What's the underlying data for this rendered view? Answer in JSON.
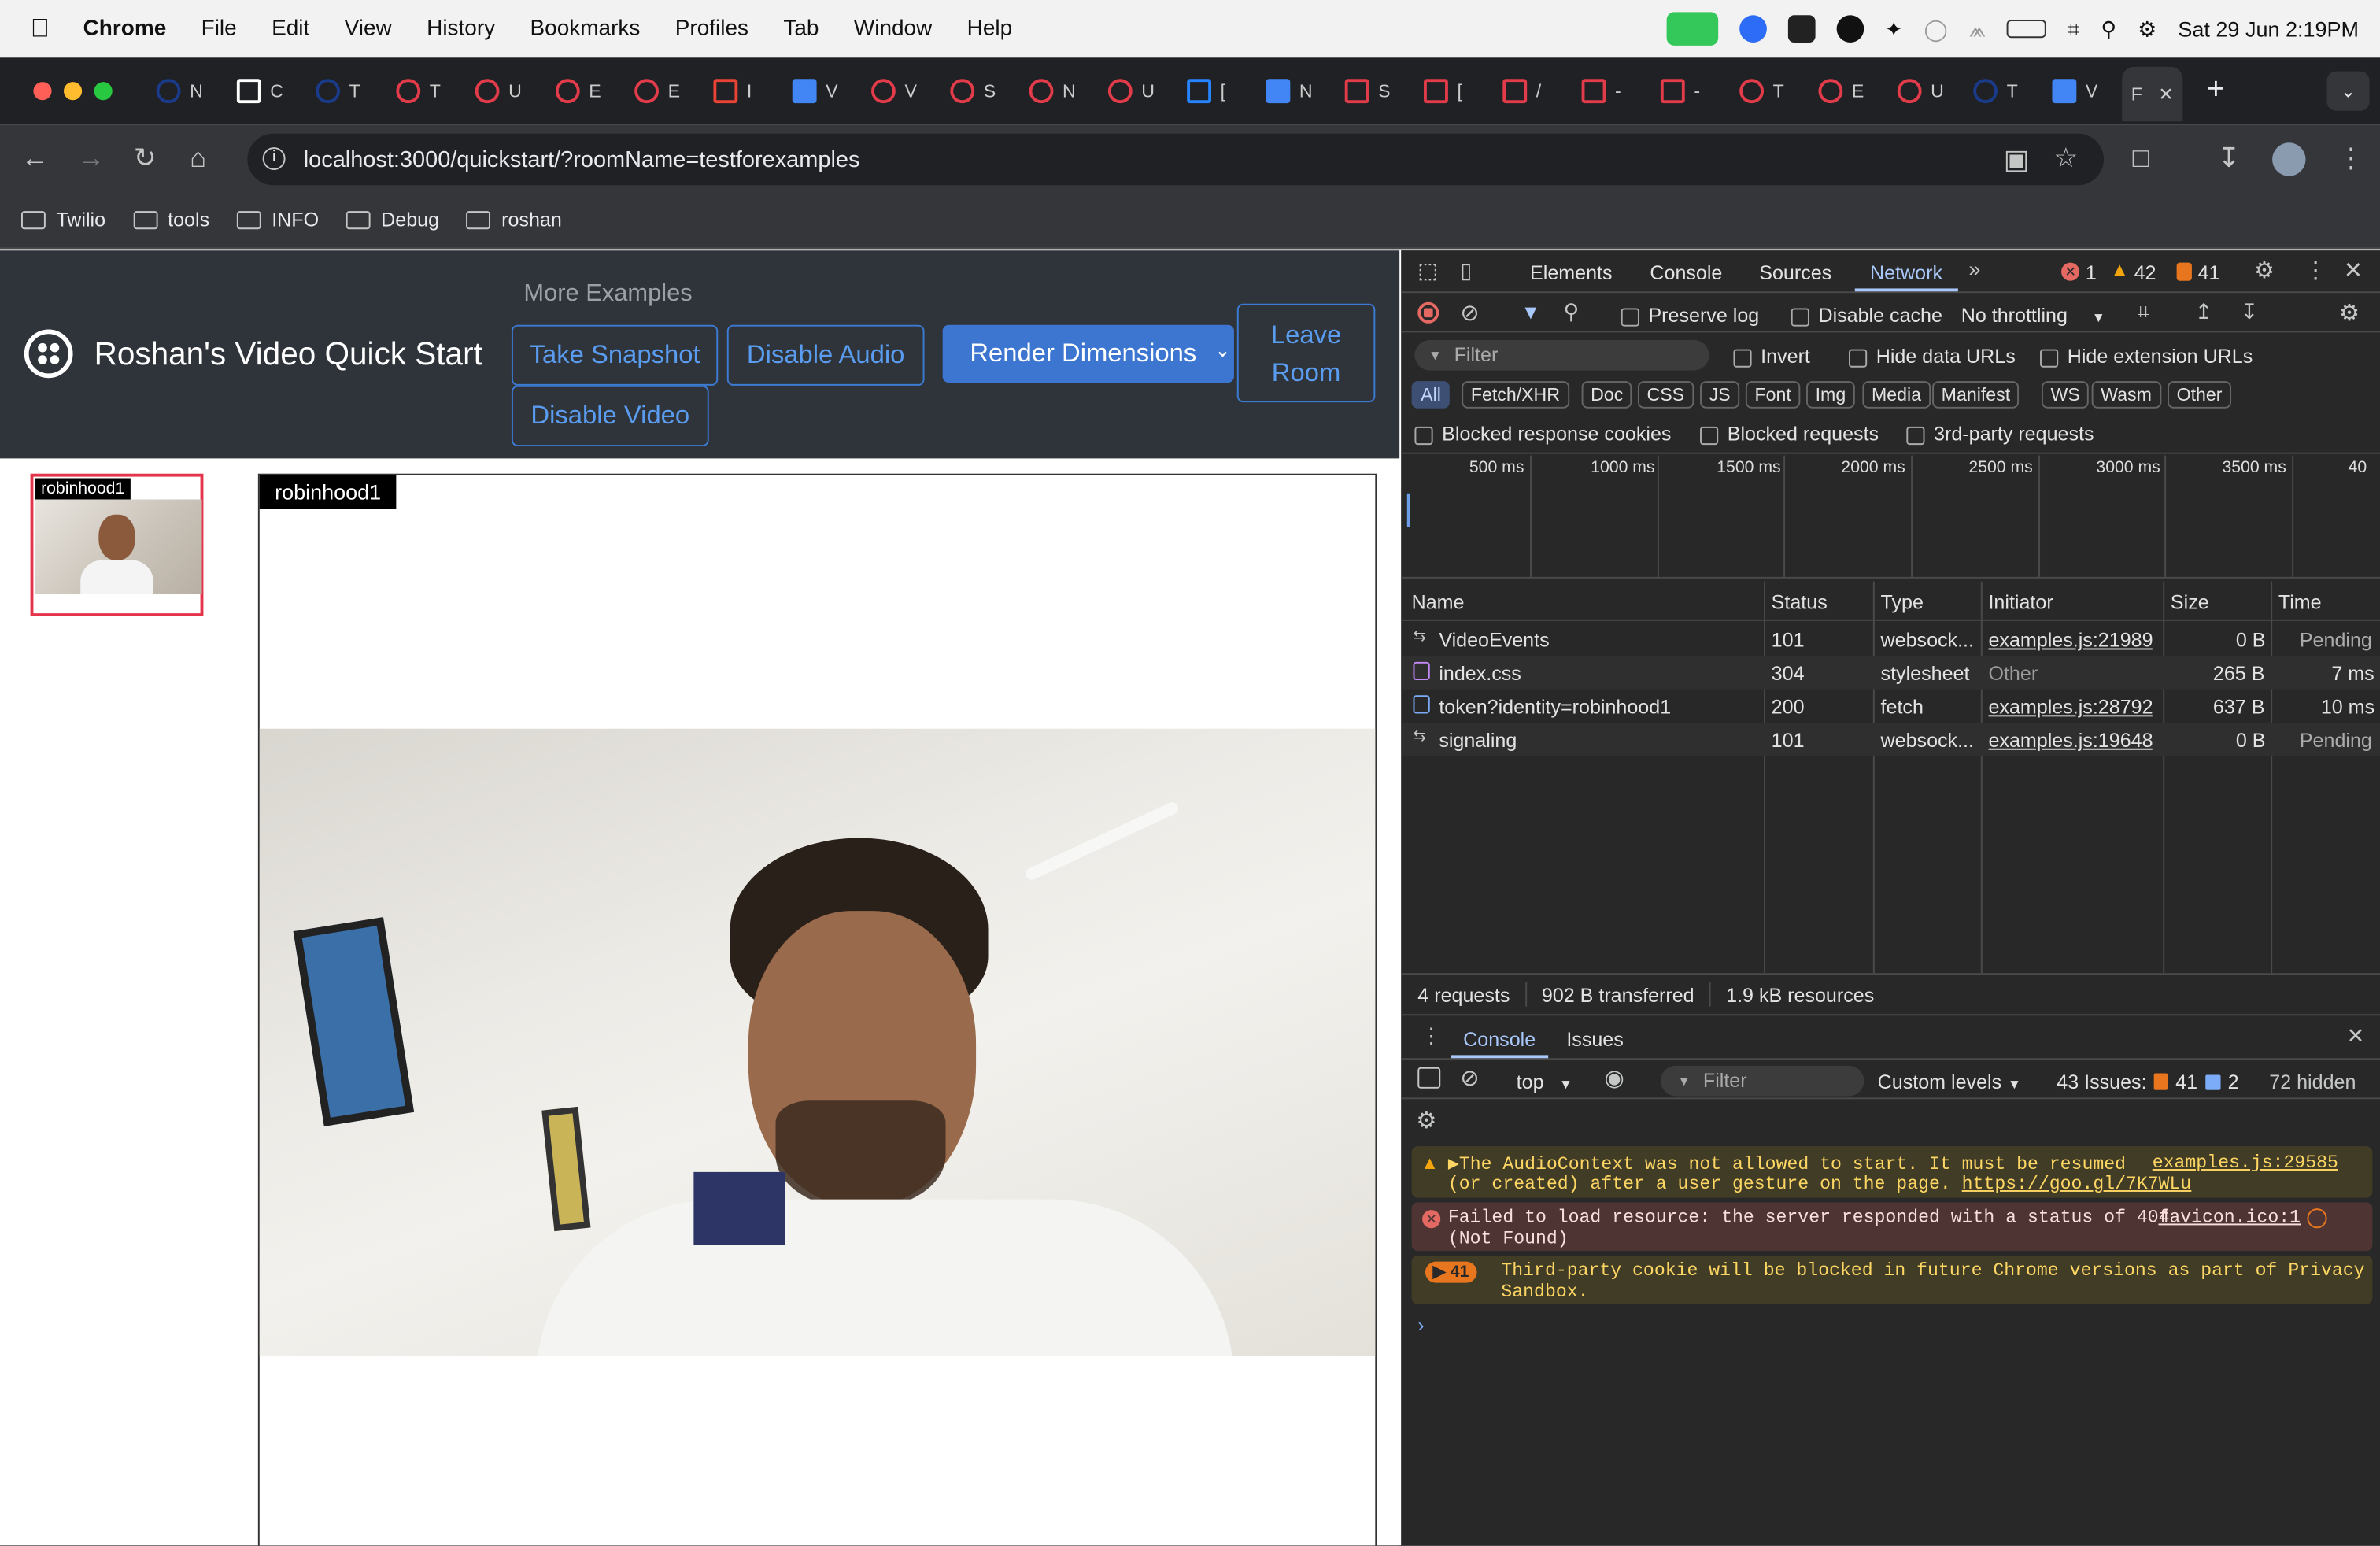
{
  "menubar": {
    "app": "Chrome",
    "items": [
      "File",
      "Edit",
      "View",
      "History",
      "Bookmarks",
      "Profiles",
      "Tab",
      "Window",
      "Help"
    ],
    "datetime": "Sat 29 Jun  2:19PM"
  },
  "tabs": {
    "active_label": "F",
    "new_tab": "+"
  },
  "browser": {
    "url": "localhost:3000/quickstart/?roomName=testforexamples"
  },
  "bookmarks": [
    "Twilio",
    "tools",
    "INFO",
    "Debug",
    "roshan"
  ],
  "app": {
    "title": "Roshan's Video Quick Start",
    "more_examples": "More Examples",
    "buttons": {
      "take_snapshot": "Take Snapshot",
      "disable_audio": "Disable Audio",
      "render_dimensions": "Render Dimensions",
      "leave_room": "Leave Room",
      "disable_video": "Disable Video"
    },
    "thumb_label": "robinhood1",
    "main_label": "robinhood1"
  },
  "devtools": {
    "tabs": [
      "Elements",
      "Console",
      "Sources",
      "Network"
    ],
    "active_tab": "Network",
    "counts": {
      "errors": "1",
      "warnings": "42",
      "issues": "41"
    },
    "preserve_log": "Preserve log",
    "disable_cache": "Disable cache",
    "throttling": "No throttling",
    "filter_placeholder": "Filter",
    "invert": "Invert",
    "hide_data_urls": "Hide data URLs",
    "hide_extension_urls": "Hide extension URLs",
    "type_filters": [
      "All",
      "Fetch/XHR",
      "Doc",
      "CSS",
      "JS",
      "Font",
      "Img",
      "Media",
      "Manifest",
      "WS",
      "Wasm",
      "Other"
    ],
    "blocked_cookies": "Blocked response cookies",
    "blocked_requests": "Blocked requests",
    "third_party": "3rd-party requests",
    "ticks": [
      "500 ms",
      "1000 ms",
      "1500 ms",
      "2000 ms",
      "2500 ms",
      "3000 ms",
      "3500 ms",
      "40"
    ],
    "columns": [
      "Name",
      "Status",
      "Type",
      "Initiator",
      "Size",
      "Time"
    ],
    "rows": [
      {
        "name": "VideoEvents",
        "status": "101",
        "type": "websock...",
        "initiator": "examples.js:21989",
        "size": "0 B",
        "time": "Pending"
      },
      {
        "name": "index.css",
        "status": "304",
        "type": "stylesheet",
        "initiator": "Other",
        "size": "265 B",
        "time": "7 ms"
      },
      {
        "name": "token?identity=robinhood1",
        "status": "200",
        "type": "fetch",
        "initiator": "examples.js:28792",
        "size": "637 B",
        "time": "10 ms"
      },
      {
        "name": "signaling",
        "status": "101",
        "type": "websock...",
        "initiator": "examples.js:19648",
        "size": "0 B",
        "time": "Pending"
      }
    ],
    "summary": {
      "requests": "4 requests",
      "transferred": "902 B transferred",
      "resources": "1.9 kB resources"
    },
    "drawer_tabs": [
      "Console",
      "Issues"
    ],
    "console": {
      "context": "top",
      "filter": "Filter",
      "levels": "Custom levels",
      "issues_label": "43 Issues:",
      "issues_warn": "41",
      "issues_info": "2",
      "hidden": "72 hidden",
      "messages": [
        {
          "level": "warn",
          "line1": "▶The AudioContext was not allowed to start. It must be resumed",
          "line2": "(or created) after a user gesture on the page. ",
          "link": "https://goo.gl/7K7WLu",
          "source": "examples.js:29585"
        },
        {
          "level": "error",
          "line1": "Failed to load resource: the server responded with a status of 404",
          "line2": "(Not Found)",
          "source": "favicon.ico:1"
        },
        {
          "level": "issue",
          "count": "41",
          "line1": "Third-party cookie will be blocked in future Chrome versions as part of Privacy",
          "line2": "Sandbox."
        }
      ]
    }
  }
}
